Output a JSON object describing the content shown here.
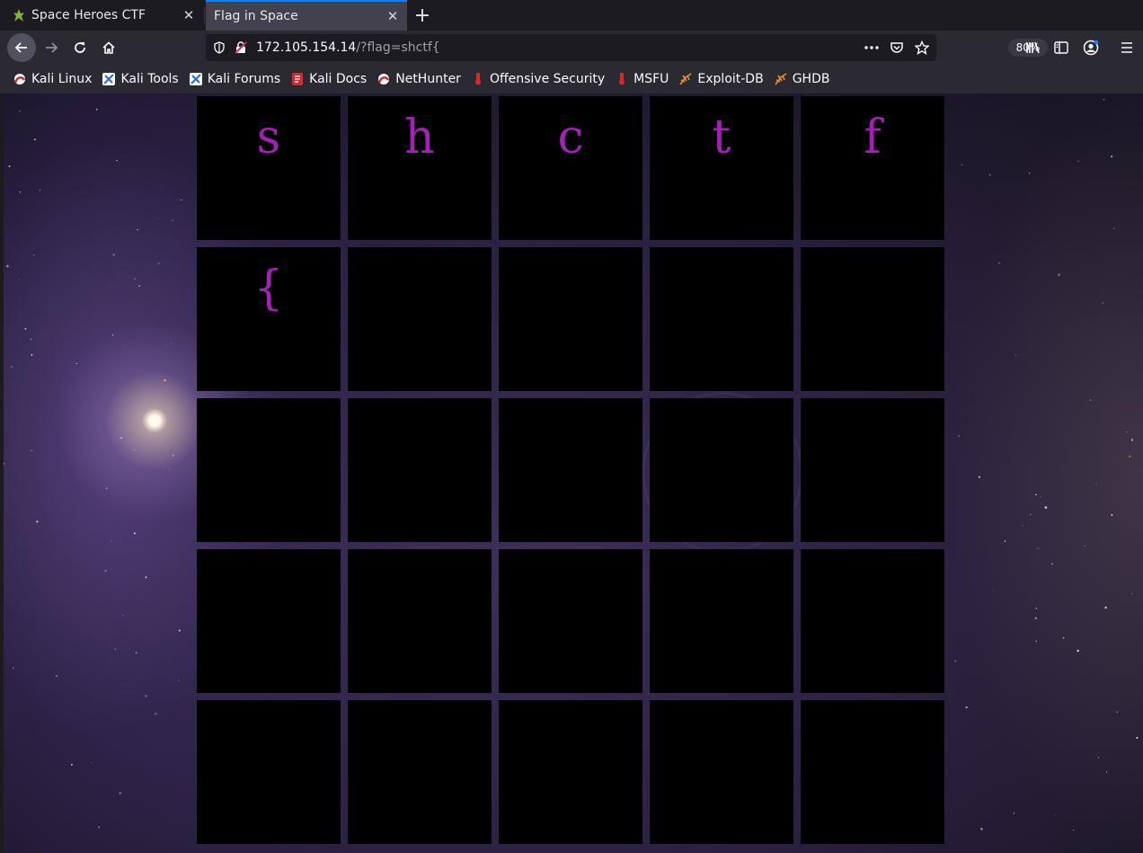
{
  "browser": {
    "tabs": [
      {
        "title": "Space Heroes CTF",
        "icon": "kali-dragon-icon"
      },
      {
        "title": "Flag in Space",
        "icon": ""
      }
    ],
    "url": {
      "host": "172.105.154.14",
      "path": "/?flag=shctf{"
    },
    "zoom": "80%",
    "bookmarks": [
      {
        "label": "Kali Linux",
        "icon": "kali-icon"
      },
      {
        "label": "Kali Tools",
        "icon": "kali-tools-icon"
      },
      {
        "label": "Kali Forums",
        "icon": "kali-forums-icon"
      },
      {
        "label": "Kali Docs",
        "icon": "kali-docs-icon"
      },
      {
        "label": "NetHunter",
        "icon": "nethunter-icon"
      },
      {
        "label": "Offensive Security",
        "icon": "offsec-icon"
      },
      {
        "label": "MSFU",
        "icon": "msfu-icon"
      },
      {
        "label": "Exploit-DB",
        "icon": "exploitdb-icon"
      },
      {
        "label": "GHDB",
        "icon": "ghdb-icon"
      }
    ]
  },
  "page": {
    "grid": {
      "rows": 5,
      "cols": 5,
      "letters": [
        "s",
        "h",
        "c",
        "t",
        "f",
        "{",
        "",
        "",
        "",
        "",
        "",
        "",
        "",
        "",
        "",
        "",
        "",
        "",
        "",
        "",
        "",
        "",
        "",
        "",
        ""
      ],
      "letter_color": "#a321b6",
      "cell_color": "#000000"
    }
  }
}
